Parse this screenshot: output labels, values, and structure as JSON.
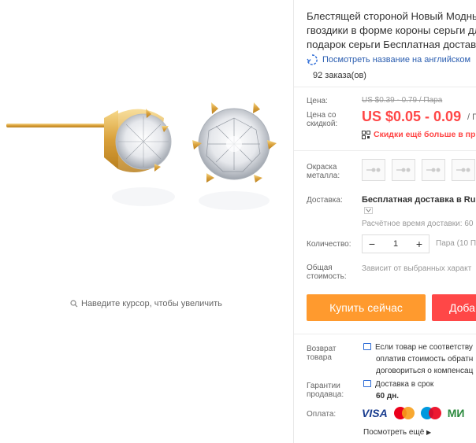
{
  "gallery": {
    "zoom_hint": "Наведите курсор, чтобы увеличить"
  },
  "product": {
    "title_lines": [
      "Блестящей стороной Новый Модны",
      "гвоздики в форме короны серьги дл",
      "подарок серьги Бесплатная доставк"
    ],
    "translate_link": "Посмотреть название на английском",
    "orders": "92 заказа(ов)"
  },
  "price": {
    "label": "Цена:",
    "old": "US $0.39 - 0.79 / Пара",
    "discount_label_1": "Цена со",
    "discount_label_2": "скидкой:",
    "current": "US $0.05 - 0.09",
    "unit": "/ П",
    "promo": "Скидки ещё больше в при"
  },
  "color": {
    "label_1": "Окраска",
    "label_2": "металла:",
    "swatch_count_icon": "earring-thumbnail"
  },
  "shipping": {
    "label": "Доставка:",
    "method": "Бесплатная доставка в Russ",
    "time": "Расчётное время доставки: 60"
  },
  "quantity": {
    "label": "Количество:",
    "minus": "−",
    "value": "1",
    "plus": "+",
    "available": "Пара (10 П"
  },
  "total": {
    "label_1": "Общая",
    "label_2": "стоимость:",
    "text": "Зависит от выбранных характ"
  },
  "actions": {
    "buy": "Купить сейчас",
    "cart": "Доба"
  },
  "returns": {
    "label_1": "Возврат",
    "label_2": "товара",
    "line_1": "Если товар не соответству",
    "line_2": "оплатив стоимость обратн",
    "line_3": "договориться о компенсац"
  },
  "guarantee": {
    "label_1": "Гарантии",
    "label_2": "продавца:",
    "line_1": "Доставка в срок",
    "line_2": "60 дн."
  },
  "payment": {
    "label": "Оплата:",
    "visa": "VISA",
    "mir": "МИ",
    "more": "Посмотреть ещё"
  },
  "colors": {
    "accent_red": "#ff4747",
    "buy_orange": "#ff9a2e",
    "link_blue": "#2a5db0",
    "gold": "#e0a93a"
  }
}
